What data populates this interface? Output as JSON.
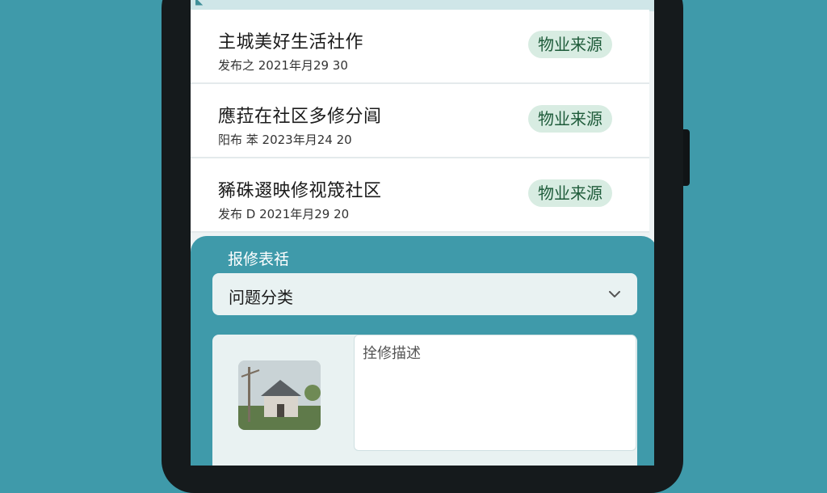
{
  "notices": [
    {
      "title": "主城美好生活社作",
      "date": "发布之 2021年月29 30",
      "badge": "物业来源"
    },
    {
      "title": "應菈在社区多修分阊",
      "date": "阳布 苯 2023年月24 20",
      "badge": "物业来源"
    },
    {
      "title": "豨硃逫映修视筬社区",
      "date": "发布 D 2021年月29 20",
      "badge": "物业来源"
    }
  ],
  "form": {
    "title": "报修表䄆",
    "category_label": "问题分类",
    "description_placeholder": "拴修描述"
  },
  "colors": {
    "background": "#3f9aaa",
    "badge_bg": "#d8ece2",
    "badge_text": "#1e5b3a"
  },
  "icons": [
    "back-icon",
    "chevron-down-icon"
  ]
}
